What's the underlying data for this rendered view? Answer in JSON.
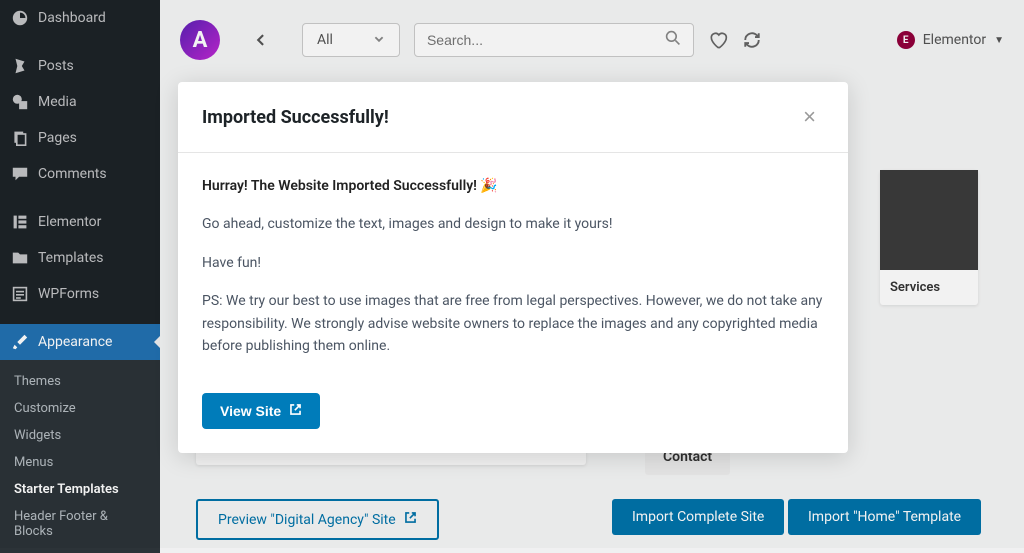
{
  "sidebar": {
    "dashboard": "Dashboard",
    "posts": "Posts",
    "media": "Media",
    "pages": "Pages",
    "comments": "Comments",
    "elementor": "Elementor",
    "templates": "Templates",
    "wpforms": "WPForms",
    "appearance": "Appearance",
    "submenu": {
      "themes": "Themes",
      "customize": "Customize",
      "widgets": "Widgets",
      "menus": "Menus",
      "starter_templates": "Starter Templates",
      "header_footer": "Header Footer & Blocks"
    }
  },
  "toolbar": {
    "filter_label": "All",
    "search_placeholder": "Search...",
    "builder_label": "Elementor"
  },
  "cards": {
    "services": "Services",
    "contact": "Contact"
  },
  "footer": {
    "preview": "Preview \"Digital Agency\" Site",
    "import_site": "Import Complete Site",
    "import_home": "Import \"Home\" Template"
  },
  "modal": {
    "title": "Imported Successfully!",
    "lead": "Hurray! The Website Imported Successfully! 🎉",
    "go_ahead": "Go ahead, customize the text, images and design to make it yours!",
    "have_fun": "Have fun!",
    "ps": "PS: We try our best to use images that are free from legal perspectives. However, we do not take any responsibility. We strongly advise website owners to replace the images and any copyrighted media before publishing them online.",
    "view_site": "View Site"
  }
}
